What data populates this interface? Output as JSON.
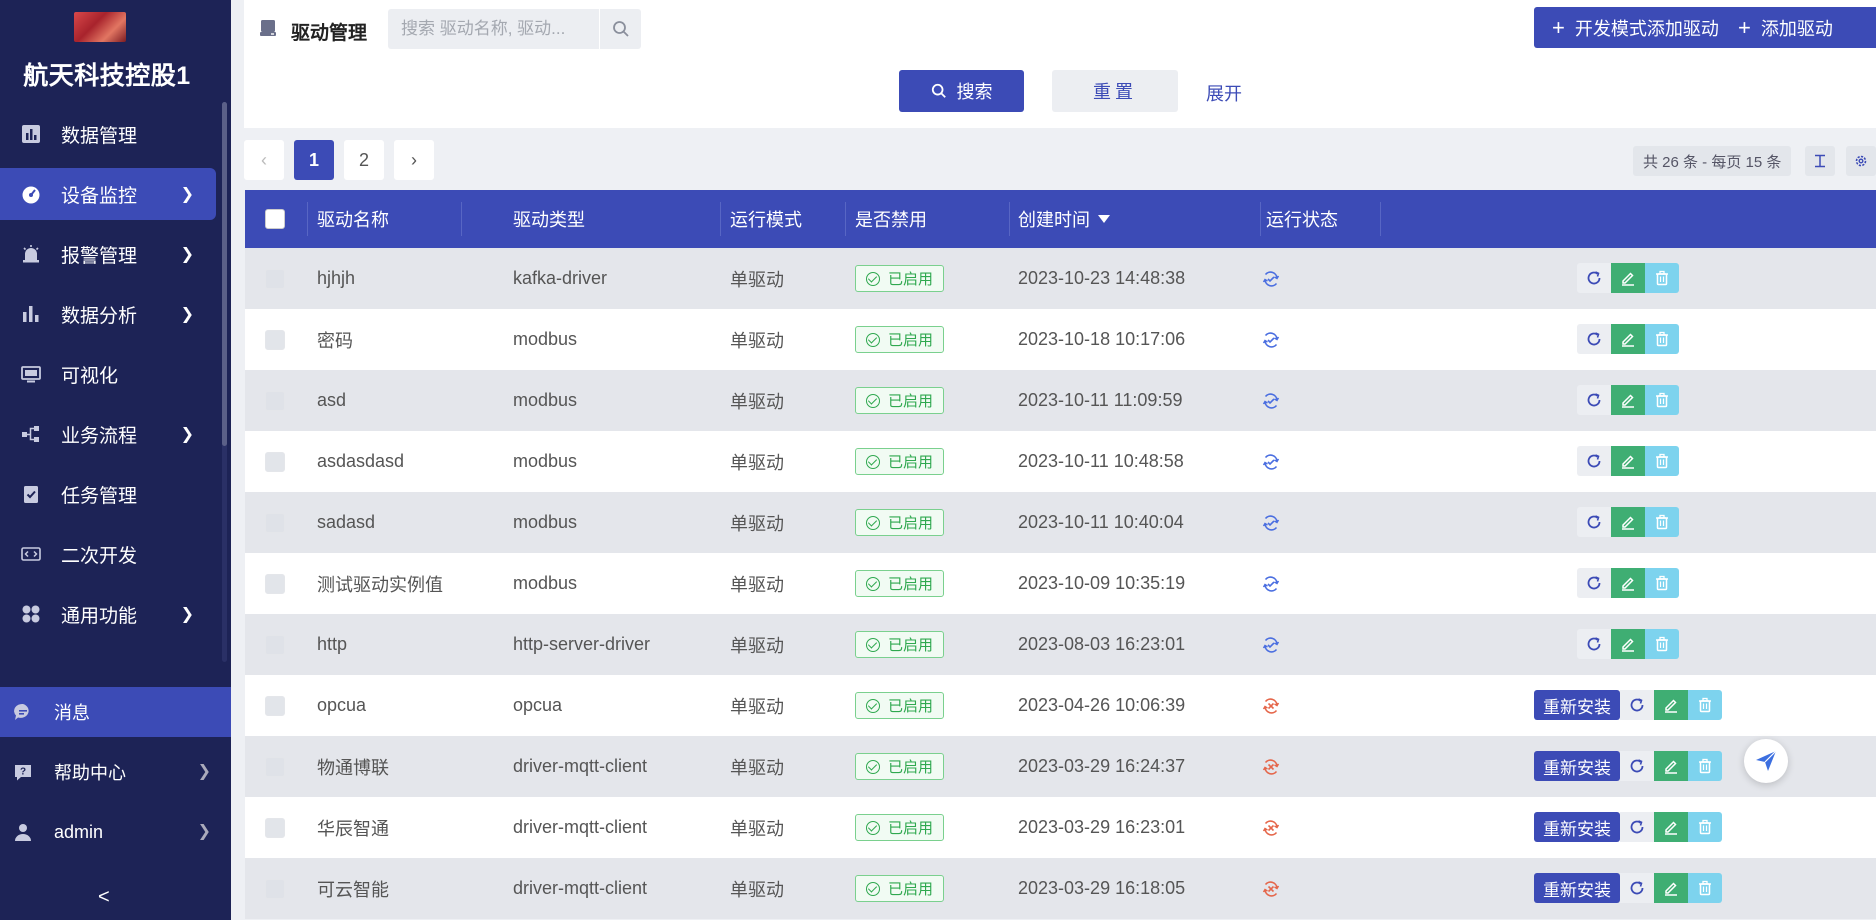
{
  "sidebar": {
    "company": "航天科技控股1",
    "items": [
      {
        "label": "数据管理",
        "icon": "bar-chart-icon",
        "chevron": false,
        "active": false
      },
      {
        "label": "设备监控",
        "icon": "dashboard-icon",
        "chevron": true,
        "active": true
      },
      {
        "label": "报警管理",
        "icon": "alarm-icon",
        "chevron": true,
        "active": false
      },
      {
        "label": "数据分析",
        "icon": "analytics-icon",
        "chevron": true,
        "active": false
      },
      {
        "label": "可视化",
        "icon": "monitor-icon",
        "chevron": false,
        "active": false
      },
      {
        "label": "业务流程",
        "icon": "flow-icon",
        "chevron": true,
        "active": false
      },
      {
        "label": "任务管理",
        "icon": "task-icon",
        "chevron": false,
        "active": false
      },
      {
        "label": "二次开发",
        "icon": "code-icon",
        "chevron": false,
        "active": false
      },
      {
        "label": "通用功能",
        "icon": "grid-icon",
        "chevron": true,
        "active": false
      }
    ],
    "bottom": [
      {
        "label": "消息",
        "icon": "message-icon",
        "active": true
      },
      {
        "label": "帮助中心",
        "icon": "help-icon",
        "active": false
      },
      {
        "label": "admin",
        "icon": "user-icon",
        "active": false
      }
    ],
    "collapse": "<"
  },
  "header": {
    "title": "驱动管理",
    "search_placeholder": "搜索 驱动名称, 驱动...",
    "btn_dev_add": "开发模式添加驱动",
    "btn_add": "添加驱动"
  },
  "filter": {
    "search": "搜索",
    "reset": "重置",
    "expand": "展开"
  },
  "pagination": {
    "pages": [
      "1",
      "2"
    ],
    "current": "1",
    "total_text": "共 26 条 - 每页 15 条"
  },
  "table": {
    "columns": [
      "驱动名称",
      "驱动类型",
      "运行模式",
      "是否禁用",
      "创建时间",
      "运行状态"
    ],
    "rows": [
      {
        "name": "hjhjh",
        "type": "kafka-driver",
        "mode": "单驱动",
        "status": "已启用",
        "created": "2023-10-23 14:48:38",
        "running": true
      },
      {
        "name": "密码",
        "type": "modbus",
        "mode": "单驱动",
        "status": "已启用",
        "created": "2023-10-18 10:17:06",
        "running": true
      },
      {
        "name": "asd",
        "type": "modbus",
        "mode": "单驱动",
        "status": "已启用",
        "created": "2023-10-11 11:09:59",
        "running": true
      },
      {
        "name": "asdasdasd",
        "type": "modbus",
        "mode": "单驱动",
        "status": "已启用",
        "created": "2023-10-11 10:48:58",
        "running": true
      },
      {
        "name": "sadasd",
        "type": "modbus",
        "mode": "单驱动",
        "status": "已启用",
        "created": "2023-10-11 10:40:04",
        "running": true
      },
      {
        "name": "测试驱动实例值",
        "type": "modbus",
        "mode": "单驱动",
        "status": "已启用",
        "created": "2023-10-09 10:35:19",
        "running": true
      },
      {
        "name": "http",
        "type": "http-server-driver",
        "mode": "单驱动",
        "status": "已启用",
        "created": "2023-08-03 16:23:01",
        "running": true
      },
      {
        "name": "opcua",
        "type": "opcua",
        "mode": "单驱动",
        "status": "已启用",
        "created": "2023-04-26 10:06:39",
        "running": false
      },
      {
        "name": "物通博联",
        "type": "driver-mqtt-client",
        "mode": "单驱动",
        "status": "已启用",
        "created": "2023-03-29 16:24:37",
        "running": false
      },
      {
        "name": "华辰智通",
        "type": "driver-mqtt-client",
        "mode": "单驱动",
        "status": "已启用",
        "created": "2023-03-29 16:23:01",
        "running": false
      },
      {
        "name": "可云智能",
        "type": "driver-mqtt-client",
        "mode": "单驱动",
        "status": "已启用",
        "created": "2023-03-29 16:18:05",
        "running": false
      }
    ],
    "reinstall_label": "重新安装"
  },
  "colors": {
    "sidebar_bg": "#1d2356",
    "primary": "#3c4bb6",
    "success": "#2fa84f",
    "error": "#e5664a"
  }
}
